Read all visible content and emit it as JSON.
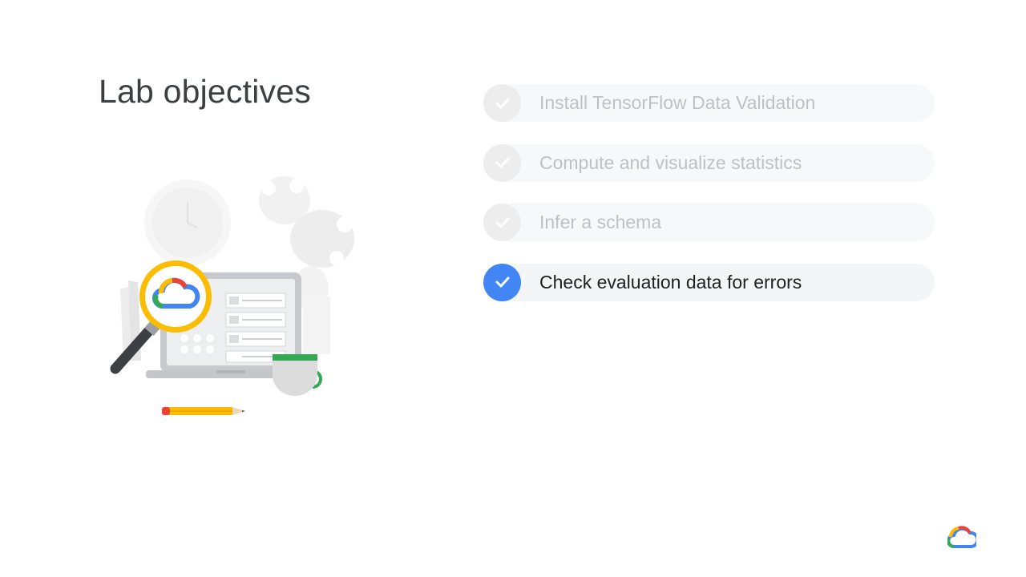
{
  "slide": {
    "title": "Lab objectives"
  },
  "objectives": [
    {
      "label": "Install TensorFlow Data Validation",
      "state": "done",
      "icon": "check-icon"
    },
    {
      "label": "Compute and visualize statistics",
      "state": "done",
      "icon": "check-icon"
    },
    {
      "label": "Infer a schema",
      "state": "done",
      "icon": "check-icon"
    },
    {
      "label": "Check evaluation data for errors",
      "state": "active",
      "icon": "check-icon"
    }
  ],
  "illustration": {
    "icons": [
      "clock-icon",
      "plant-icon",
      "laptop-icon",
      "magnifying-glass-icon",
      "google-cloud-logo-icon",
      "coffee-cup-icon",
      "pencil-icon"
    ]
  },
  "colors": {
    "accent_blue": "#4285f4",
    "google_red": "#ea4335",
    "google_yellow": "#fbbc04",
    "google_green": "#34a853",
    "title_text": "#3c4043",
    "dimmed_text": "#bdc1c6"
  }
}
